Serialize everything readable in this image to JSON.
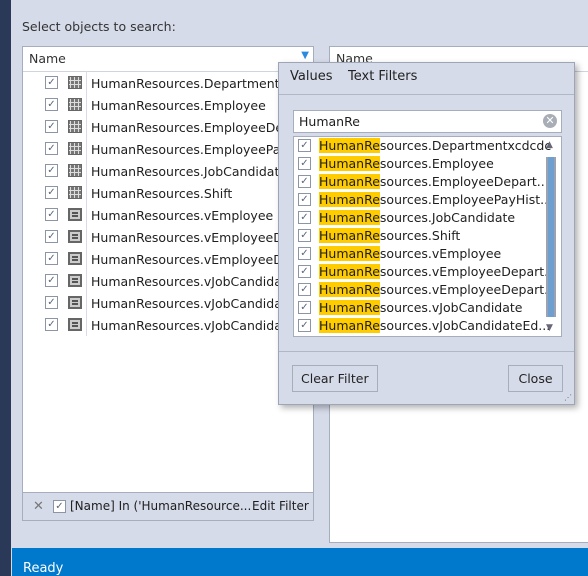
{
  "label": "Select objects to search:",
  "left_grid": {
    "header": "Name",
    "rows": [
      {
        "name": "HumanResources.Departmentxcdcdc",
        "type": "table",
        "checked": true
      },
      {
        "name": "HumanResources.Employee",
        "type": "table",
        "checked": true
      },
      {
        "name": "HumanResources.EmployeeDepartmentHistory",
        "type": "table",
        "checked": true
      },
      {
        "name": "HumanResources.EmployeePayHistory",
        "type": "table",
        "checked": true
      },
      {
        "name": "HumanResources.JobCandidate",
        "type": "table",
        "checked": true
      },
      {
        "name": "HumanResources.Shift",
        "type": "table",
        "checked": true
      },
      {
        "name": "HumanResources.vEmployee",
        "type": "view",
        "checked": true
      },
      {
        "name": "HumanResources.vEmployeeDepartment",
        "type": "view",
        "checked": true
      },
      {
        "name": "HumanResources.vEmployeeDepartmentHistory",
        "type": "view",
        "checked": true
      },
      {
        "name": "HumanResources.vJobCandidate",
        "type": "view",
        "checked": true
      },
      {
        "name": "HumanResources.vJobCandidateEducation",
        "type": "view",
        "checked": true
      },
      {
        "name": "HumanResources.vJobCandidateEmployment",
        "type": "view",
        "checked": true
      }
    ]
  },
  "filter_footer": {
    "text": "[Name] In ('HumanResource...",
    "edit": "Edit Filter",
    "checked": true
  },
  "right_grid": {
    "header": "Name"
  },
  "popup": {
    "tabs": [
      "Values",
      "Text Filters"
    ],
    "search": "HumanRe",
    "match": "HumanRe",
    "items": [
      {
        "rest": "sources.Departmentxcdcdc",
        "checked": true
      },
      {
        "rest": "sources.Employee",
        "checked": true
      },
      {
        "rest": "sources.EmployeeDepart...",
        "checked": true
      },
      {
        "rest": "sources.EmployeePayHist...",
        "checked": true
      },
      {
        "rest": "sources.JobCandidate",
        "checked": true
      },
      {
        "rest": "sources.Shift",
        "checked": true
      },
      {
        "rest": "sources.vEmployee",
        "checked": true
      },
      {
        "rest": "sources.vEmployeeDepart...",
        "checked": true
      },
      {
        "rest": "sources.vEmployeeDepart...",
        "checked": true
      },
      {
        "rest": "sources.vJobCandidate",
        "checked": true
      },
      {
        "rest": "sources.vJobCandidateEd...",
        "checked": true
      }
    ],
    "clear": "Clear Filter",
    "close": "Close"
  },
  "status": "Ready",
  "colors": {
    "highlight": "#ffcc00",
    "status_bar": "#0078cc",
    "filter_icon": "#2a8ae0"
  }
}
